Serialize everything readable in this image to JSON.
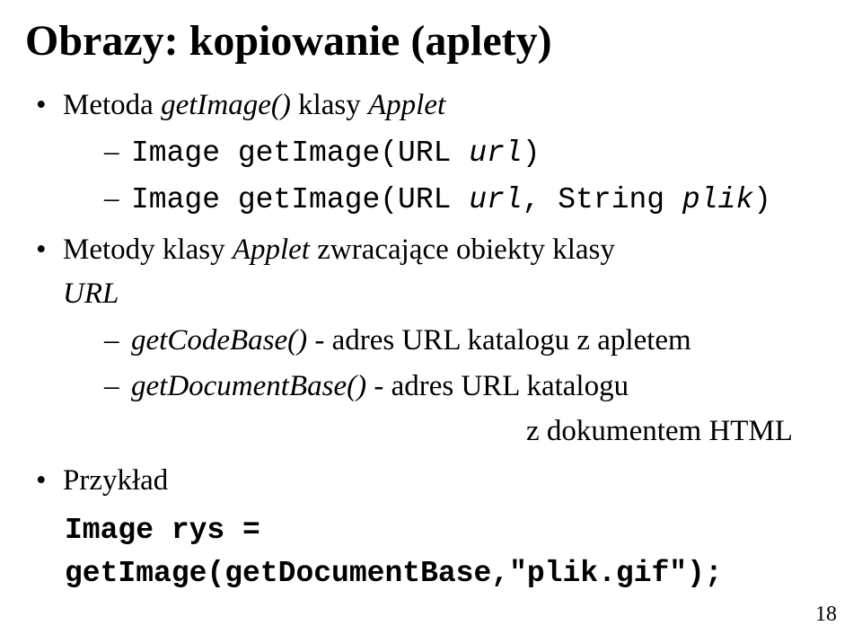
{
  "title": "Obrazy: kopiowanie (aplety)",
  "bullet1": {
    "lead": "Metoda ",
    "method": "getImage()",
    "mid": " klasy ",
    "cls": "Applet",
    "sig1a": "Image getImage(URL ",
    "sig1b": "url",
    "sig1c": ")",
    "sig2a": "Image getImage(URL ",
    "sig2b": "url",
    "sig2c": ", String ",
    "sig2d": "plik",
    "sig2e": ")"
  },
  "bullet2": {
    "lead": "Metody klasy ",
    "cls": "Applet",
    "mid": " zwracające obiekty klasy ",
    "url": "URL",
    "s1a": "getCodeBase()",
    "s1b": " - adres URL katalogu z apletem",
    "s2a": "getDocumentBase()",
    "s2b": "  - adres URL katalogu",
    "s2c": "z dokumentem HTML"
  },
  "bullet3": {
    "label": "Przykład",
    "code1": "Image rys =",
    "code2": "getImage(getDocumentBase,\"plik.gif\");"
  },
  "page_number": "18"
}
